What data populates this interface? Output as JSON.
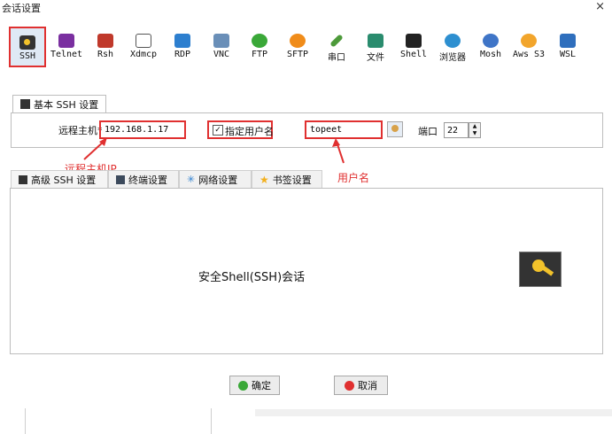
{
  "window": {
    "title": "会话设置",
    "close": "×"
  },
  "toolbar": [
    {
      "label": "SSH",
      "icon": "ssh-key-icon",
      "color": "#333333",
      "selected": true
    },
    {
      "label": "Telnet",
      "icon": "telnet-icon",
      "color": "#7a2fa0"
    },
    {
      "label": "Rsh",
      "icon": "rsh-icon",
      "color": "#c0392b"
    },
    {
      "label": "Xdmcp",
      "icon": "xdmcp-icon",
      "color": "#555555"
    },
    {
      "label": "RDP",
      "icon": "rdp-icon",
      "color": "#2d7fcf"
    },
    {
      "label": "VNC",
      "icon": "vnc-icon",
      "color": "#6a8fb8"
    },
    {
      "label": "FTP",
      "icon": "ftp-icon",
      "color": "#3aa838"
    },
    {
      "label": "SFTP",
      "icon": "sftp-icon",
      "color": "#f08c1a"
    },
    {
      "label": "串口",
      "icon": "serial-icon",
      "color": "#4d9a3a"
    },
    {
      "label": "文件",
      "icon": "file-icon",
      "color": "#2a8c6e"
    },
    {
      "label": "Shell",
      "icon": "shell-icon",
      "color": "#222222"
    },
    {
      "label": "浏览器",
      "icon": "browser-icon",
      "color": "#2d8fd0"
    },
    {
      "label": "Mosh",
      "icon": "mosh-icon",
      "color": "#3f75c7"
    },
    {
      "label": "Aws S3",
      "icon": "aws-icon",
      "color": "#f2a52b"
    },
    {
      "label": "WSL",
      "icon": "wsl-icon",
      "color": "#2f6fbd"
    }
  ],
  "basic": {
    "tab_label": "基本 SSH 设置",
    "remote_host_label": "远程主机",
    "required_mark": "*",
    "remote_host_value": "192.168.1.17",
    "specify_user_label": "指定用户名",
    "username_value": "topeet",
    "port_label": "端口",
    "port_value": "22"
  },
  "annotations": {
    "remote_host": "远程主机IP",
    "username": "用户名"
  },
  "subtabs": [
    {
      "label": "高级 SSH 设置",
      "icon": "wrench-icon"
    },
    {
      "label": "终端设置",
      "icon": "terminal-icon"
    },
    {
      "label": "网络设置",
      "icon": "network-icon"
    },
    {
      "label": "书签设置",
      "icon": "star-icon"
    }
  ],
  "main": {
    "description": "安全Shell(SSH)会话"
  },
  "buttons": {
    "ok": "确定",
    "cancel": "取消"
  },
  "colors": {
    "accent_red": "#e03030",
    "selected_bg": "#dfe9f5"
  }
}
